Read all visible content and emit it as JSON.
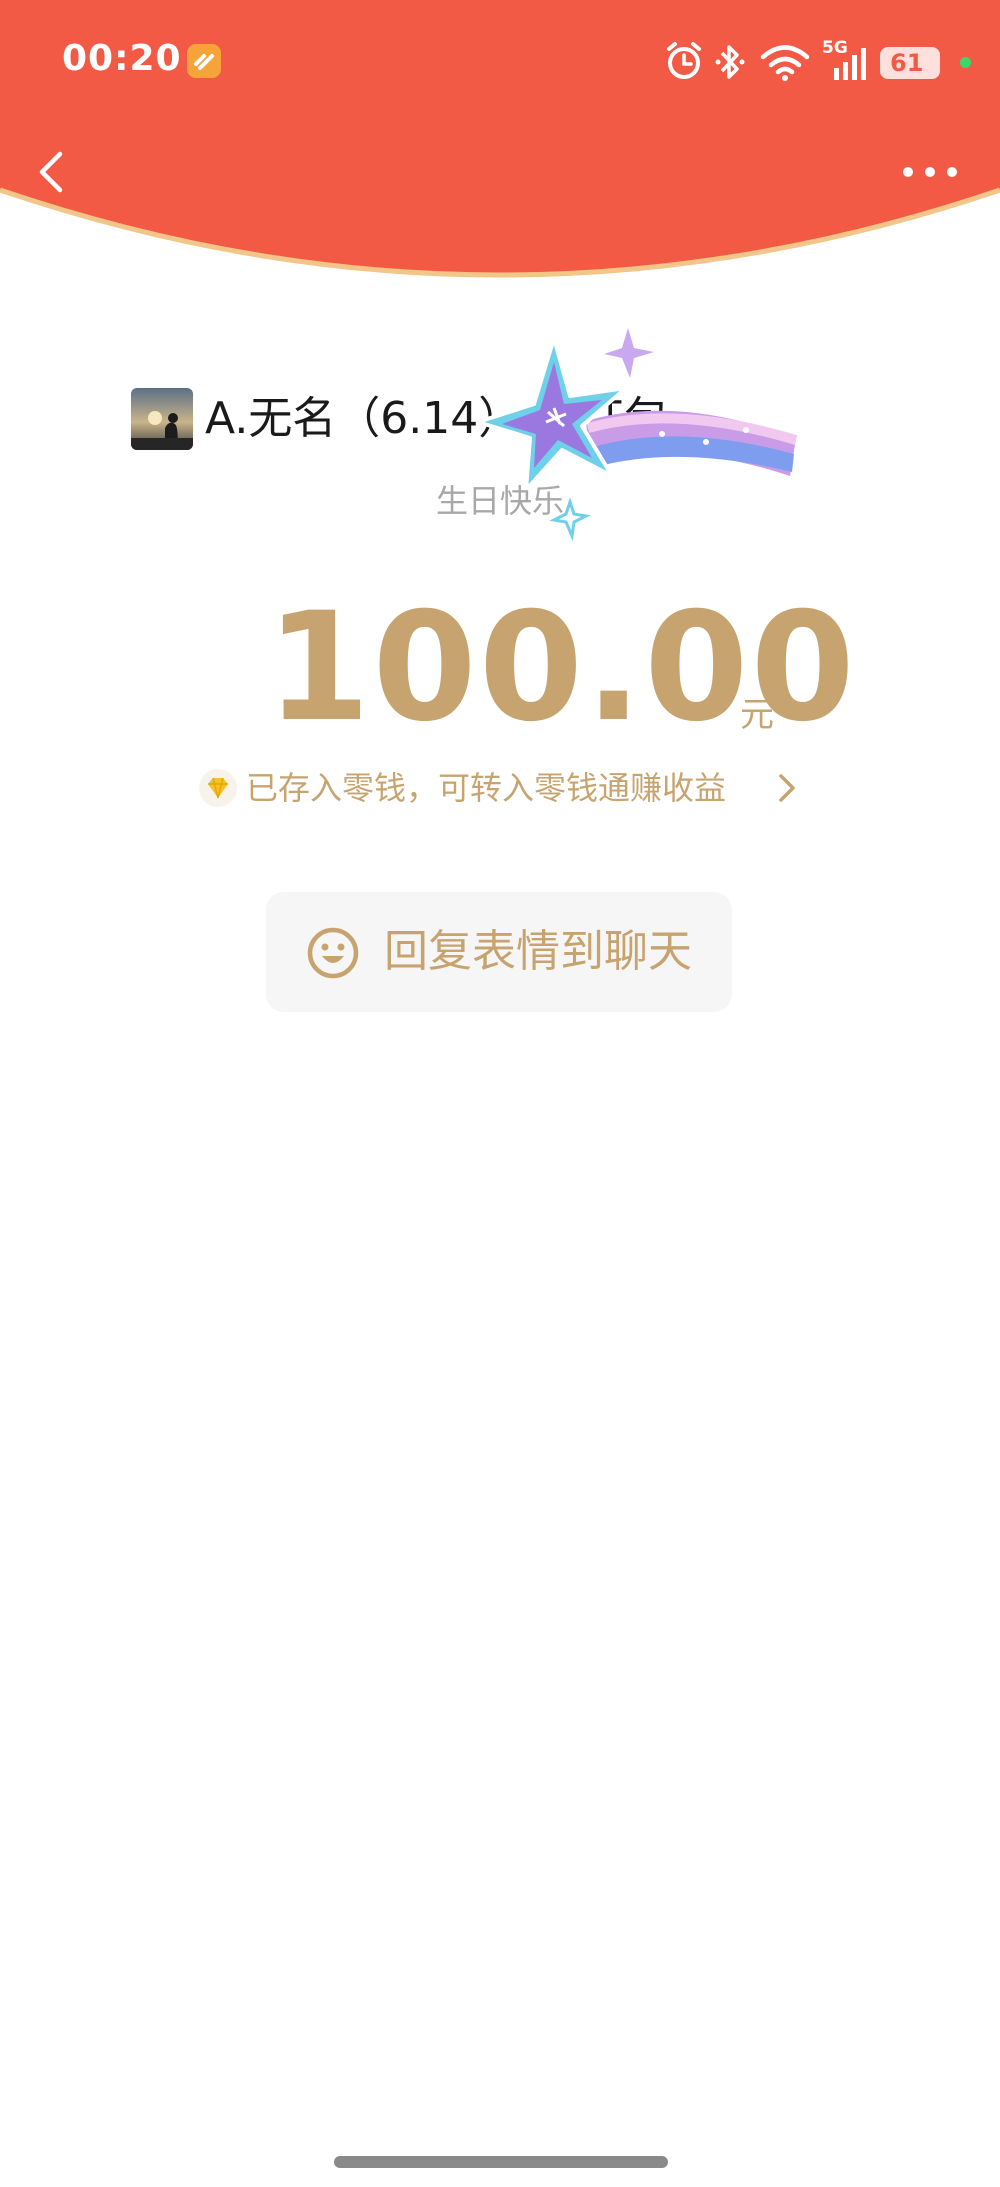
{
  "status_bar": {
    "time": "00:20",
    "network_label": "5G",
    "battery": "61"
  },
  "colors": {
    "header_red": "#f35a46",
    "gold": "#c7a46f",
    "arc_border": "#f2c589"
  },
  "icons": {
    "back": "chevron-left-icon",
    "more": "more-dots-icon",
    "notice": "diamond-icon",
    "reply": "smiley-icon",
    "arrow": "chevron-right-icon"
  },
  "packet": {
    "sender_text": "A.无名（6.14）    的红包",
    "blessing": "生日快乐",
    "amount": "100.00",
    "currency": "元",
    "notice": "已存入零钱，可转入零钱通赚收益"
  },
  "actions": {
    "reply_label": "回复表情到聊天"
  }
}
